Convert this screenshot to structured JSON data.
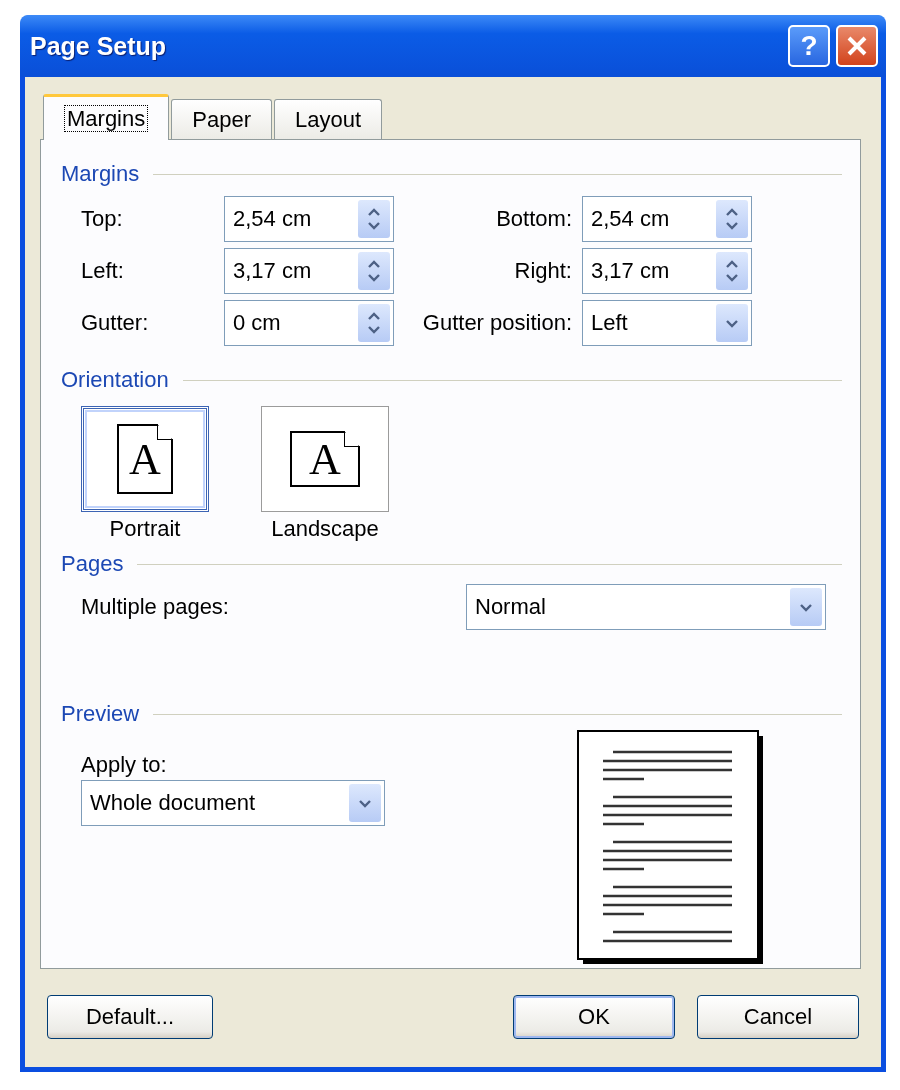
{
  "window": {
    "title": "Page Setup",
    "help_glyph": "?"
  },
  "tabs": [
    {
      "label": "Margins",
      "selected": true
    },
    {
      "label": "Paper",
      "selected": false
    },
    {
      "label": "Layout",
      "selected": false
    }
  ],
  "margins": {
    "heading": "Margins",
    "fields": [
      {
        "label": "Top:",
        "value": "2,54 cm",
        "kind": "spin"
      },
      {
        "label": "Bottom:",
        "value": "2,54 cm",
        "kind": "spin"
      },
      {
        "label": "Left:",
        "value": "3,17 cm",
        "kind": "spin"
      },
      {
        "label": "Right:",
        "value": "3,17 cm",
        "kind": "spin"
      },
      {
        "label": "Gutter:",
        "value": "0 cm",
        "kind": "spin"
      },
      {
        "label": "Gutter position:",
        "value": "Left",
        "kind": "dropdown"
      }
    ]
  },
  "orientation": {
    "heading": "Orientation",
    "options": [
      {
        "label": "Portrait",
        "glyph": "A",
        "selected": true
      },
      {
        "label": "Landscape",
        "glyph": "A",
        "selected": false
      }
    ]
  },
  "pages": {
    "heading": "Pages",
    "label": "Multiple pages:",
    "value": "Normal"
  },
  "preview": {
    "heading": "Preview",
    "label": "Apply to:",
    "value": "Whole document"
  },
  "buttons": [
    {
      "label": "Default...",
      "default": false
    },
    {
      "label": "OK",
      "default": true
    },
    {
      "label": "Cancel",
      "default": false
    }
  ]
}
